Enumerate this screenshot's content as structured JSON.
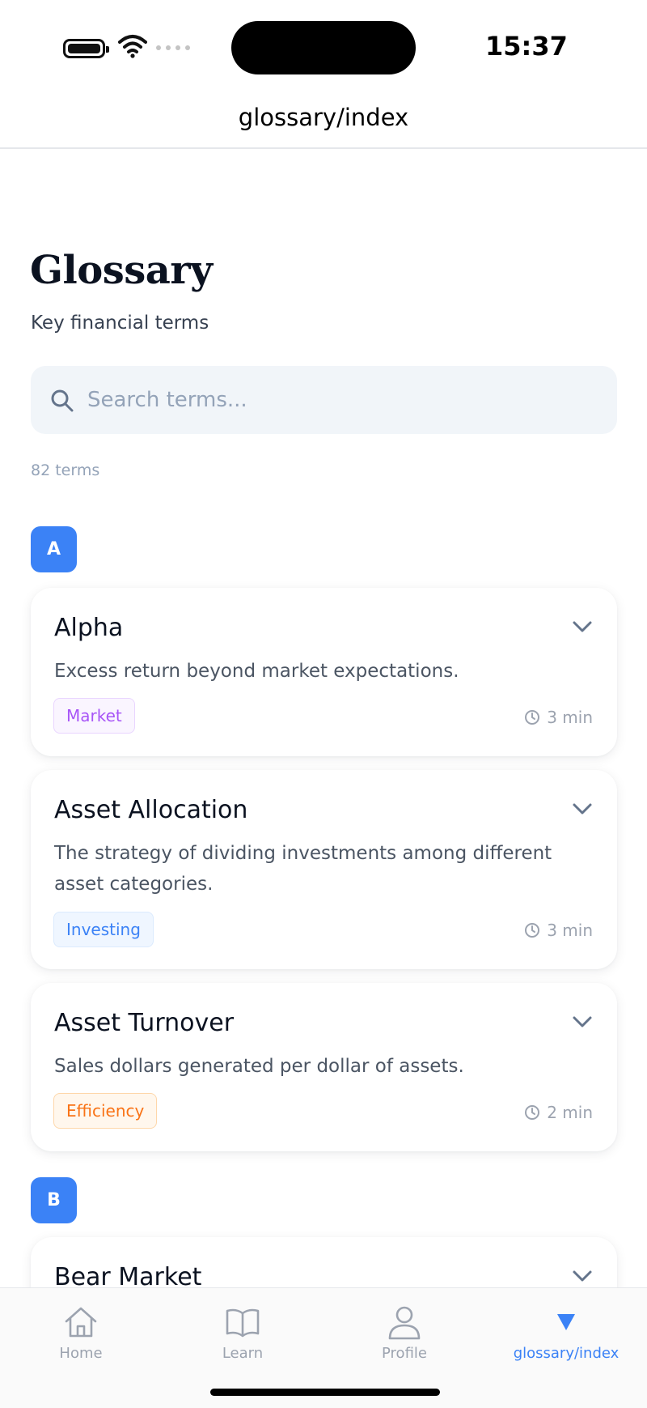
{
  "status_bar": {
    "time": "15:37"
  },
  "header": {
    "title": "glossary/index"
  },
  "page": {
    "title": "Glossary",
    "subtitle": "Key financial terms",
    "search_placeholder": "Search terms...",
    "term_count": "82 terms"
  },
  "sections": [
    {
      "letter": "A",
      "terms": [
        {
          "name": "Alpha",
          "description": "Excess return beyond market expectations.",
          "category": "Market",
          "read_time": "3 min"
        },
        {
          "name": "Asset Allocation",
          "description": "The strategy of dividing investments among different asset categories.",
          "category": "Investing",
          "read_time": "3 min"
        },
        {
          "name": "Asset Turnover",
          "description": "Sales dollars generated per dollar of assets.",
          "category": "Efficiency",
          "read_time": "2 min"
        }
      ]
    },
    {
      "letter": "B",
      "terms": [
        {
          "name": "Bear Market"
        }
      ]
    }
  ],
  "colors": {
    "accent": "#3b82f6",
    "tag_market": "#a855f7",
    "tag_investing": "#3b82f6",
    "tag_efficiency": "#f97316"
  },
  "tabs": [
    {
      "label": "Home",
      "icon": "home-icon",
      "active": false
    },
    {
      "label": "Learn",
      "icon": "book-icon",
      "active": false
    },
    {
      "label": "Profile",
      "icon": "user-icon",
      "active": false
    },
    {
      "label": "glossary/index",
      "icon": "triangle-down-icon",
      "active": true
    }
  ]
}
